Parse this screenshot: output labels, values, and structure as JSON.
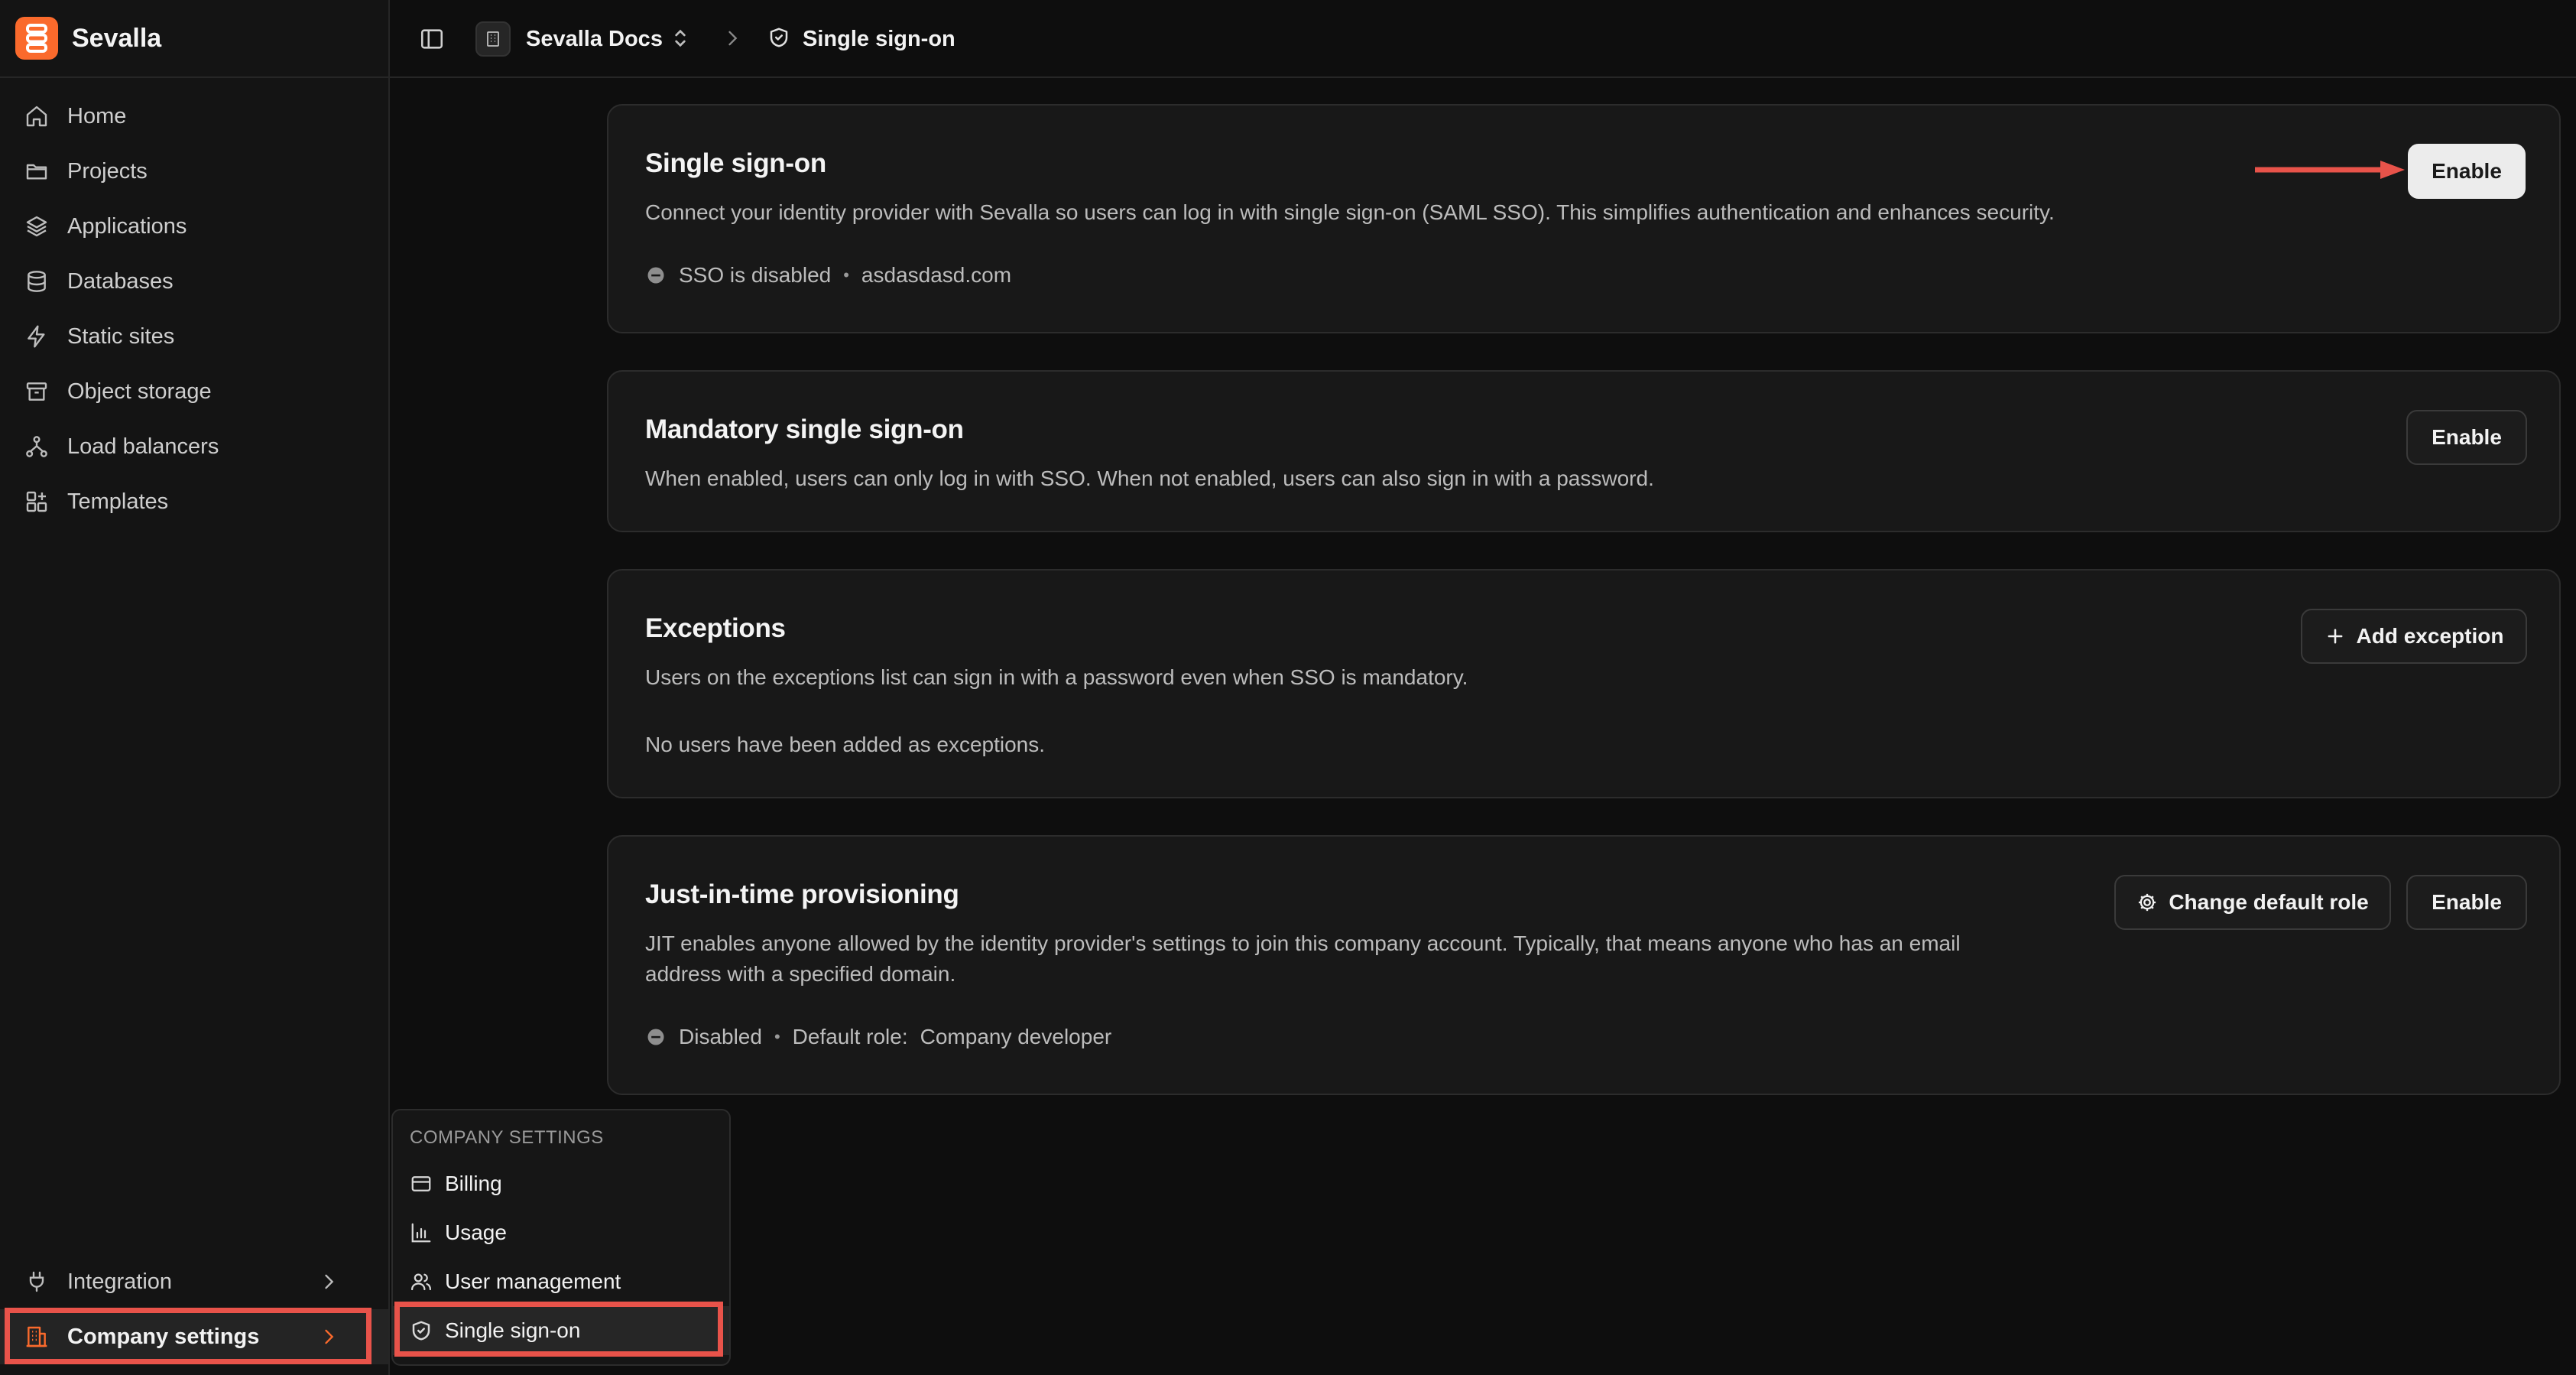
{
  "app": {
    "brand": "Sevalla",
    "org_name": "Sevalla Docs",
    "current_page": "Single sign-on",
    "accent_color": "#fa6a2c",
    "highlight_color": "#e8534a"
  },
  "sidebar": {
    "items": [
      {
        "label": "Home",
        "icon": "home-icon"
      },
      {
        "label": "Projects",
        "icon": "folder-icon"
      },
      {
        "label": "Applications",
        "icon": "layers-icon"
      },
      {
        "label": "Databases",
        "icon": "database-icon"
      },
      {
        "label": "Static sites",
        "icon": "lightning-icon"
      },
      {
        "label": "Object storage",
        "icon": "archive-icon"
      },
      {
        "label": "Load balancers",
        "icon": "network-icon"
      },
      {
        "label": "Templates",
        "icon": "templates-icon"
      }
    ],
    "bottom": {
      "integration": "Integration",
      "company_settings": "Company settings"
    }
  },
  "cards": {
    "sso": {
      "title": "Single sign-on",
      "description": "Connect your identity provider with Sevalla so users can log in with single sign-on (SAML SSO). This simplifies authentication and enhances security.",
      "status": "SSO is disabled",
      "domain": "asdasdasd.com",
      "button": "Enable"
    },
    "mandatory": {
      "title": "Mandatory single sign-on",
      "description": "When enabled, users can only log in with SSO. When not enabled, users can also sign in with a password.",
      "button": "Enable"
    },
    "exceptions": {
      "title": "Exceptions",
      "description": "Users on the exceptions list can sign in with a password even when SSO is mandatory.",
      "empty": "No users have been added as exceptions.",
      "button": "Add exception"
    },
    "jit": {
      "title": "Just-in-time provisioning",
      "description_line1": "JIT enables anyone allowed by the identity provider's settings to join this company account. Typically, that means anyone who has an email",
      "description_line2": "address with a specified domain.",
      "status": "Disabled",
      "role_label": "Default role:",
      "role_value": "Company developer",
      "button_role": "Change default role",
      "button_enable": "Enable"
    }
  },
  "flyout": {
    "header": "COMPANY SETTINGS",
    "items": [
      {
        "label": "Billing",
        "icon": "credit-card-icon"
      },
      {
        "label": "Usage",
        "icon": "bar-chart-icon"
      },
      {
        "label": "User management",
        "icon": "users-icon"
      },
      {
        "label": "Single sign-on",
        "icon": "shield-icon"
      }
    ]
  }
}
